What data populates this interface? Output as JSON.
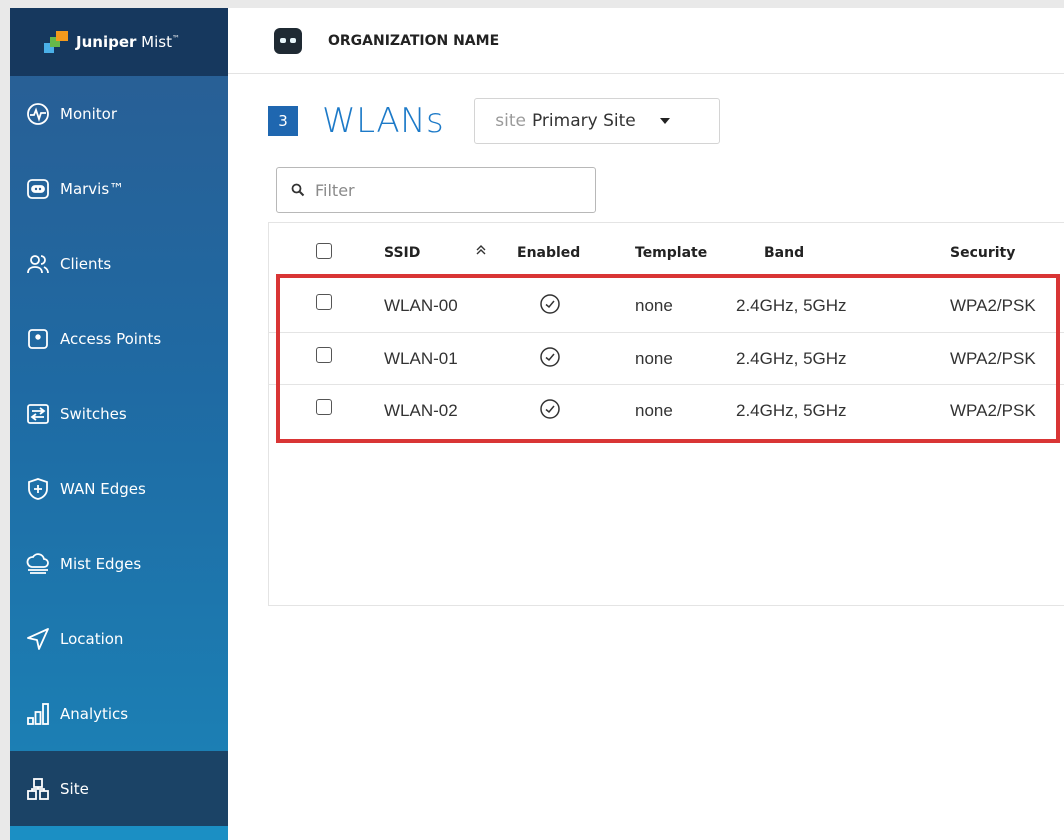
{
  "brand": {
    "name_bold": "Juniper",
    "name_rest": " Mist",
    "tm": "™"
  },
  "org": {
    "name": "ORGANIZATION NAME"
  },
  "sidebar": {
    "items": [
      {
        "label": "Monitor",
        "icon": "monitor-icon"
      },
      {
        "label": "Marvis™",
        "icon": "marvis-icon"
      },
      {
        "label": "Clients",
        "icon": "clients-icon"
      },
      {
        "label": "Access Points",
        "icon": "access-point-icon"
      },
      {
        "label": "Switches",
        "icon": "switches-icon"
      },
      {
        "label": "WAN Edges",
        "icon": "wan-edges-icon"
      },
      {
        "label": "Mist Edges",
        "icon": "mist-edges-icon"
      },
      {
        "label": "Location",
        "icon": "location-icon"
      },
      {
        "label": "Analytics",
        "icon": "analytics-icon"
      },
      {
        "label": "Site",
        "icon": "site-icon",
        "active": true
      }
    ]
  },
  "page": {
    "count": "3",
    "title": "WLANs",
    "site_selector": {
      "label": "site",
      "value": "Primary Site"
    },
    "filter": {
      "placeholder": "Filter"
    }
  },
  "table": {
    "columns": {
      "ssid": "SSID",
      "enabled": "Enabled",
      "template": "Template",
      "band": "Band",
      "security": "Security"
    },
    "sort_icon": "sort-ascending-icon",
    "rows": [
      {
        "ssid": "WLAN-00",
        "enabled": true,
        "template": "none",
        "band": "2.4GHz, 5GHz",
        "security": "WPA2/PSK"
      },
      {
        "ssid": "WLAN-01",
        "enabled": true,
        "template": "none",
        "band": "2.4GHz, 5GHz",
        "security": "WPA2/PSK"
      },
      {
        "ssid": "WLAN-02",
        "enabled": true,
        "template": "none",
        "band": "2.4GHz, 5GHz",
        "security": "WPA2/PSK"
      }
    ]
  },
  "colors": {
    "sidebar_top": "#2a5d93",
    "sidebar_bottom": "#1b84b8",
    "brand_bar": "#16385e",
    "active_nav": "#1b4366",
    "accent": "#1d7ac8",
    "badge": "#1f67b0",
    "highlight_border": "#d93535"
  }
}
